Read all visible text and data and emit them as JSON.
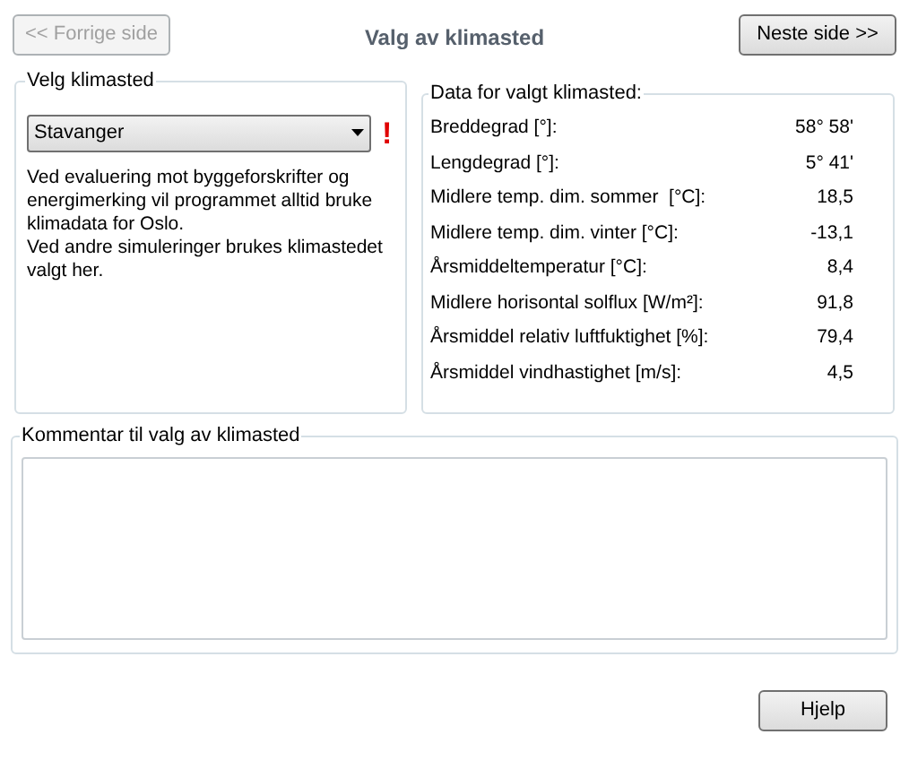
{
  "header": {
    "prev_button": {
      "label": "<< Forrige side",
      "disabled": true
    },
    "title": "Valg av klimasted",
    "next_button": {
      "label": "Neste side >>",
      "disabled": false
    }
  },
  "climate_select": {
    "legend": "Velg klimasted",
    "dropdown_value": "Stavanger",
    "warning": "!",
    "description": [
      "Ved evaluering mot byggeforskrifter og energimerking vil programmet alltid bruke klimadata for Oslo.",
      "Ved andre simuleringer brukes klimastedet valgt her."
    ]
  },
  "climate_data": {
    "legend": "Data for valgt klimasted:",
    "rows": [
      {
        "label": "Breddegrad [°]:",
        "value": "58° 58'"
      },
      {
        "label": "Lengdegrad [°]:",
        "value": "5° 41'"
      },
      {
        "label": "Midlere temp. dim. sommer  [°C]:",
        "value": "18,5"
      },
      {
        "label": "Midlere temp. dim. vinter [°C]:",
        "value": "-13,1"
      },
      {
        "label": "Årsmiddeltemperatur [°C]:",
        "value": "8,4"
      },
      {
        "label": "Midlere horisontal solflux [W/m²]:",
        "value": "91,8"
      },
      {
        "label": "Årsmiddel relativ luftfuktighet [%]:",
        "value": "79,4"
      },
      {
        "label": "Årsmiddel vindhastighet [m/s]:",
        "value": "4,5"
      }
    ]
  },
  "comment": {
    "legend": "Kommentar til valg av klimasted"
  },
  "help_button": {
    "label": "Hjelp"
  }
}
